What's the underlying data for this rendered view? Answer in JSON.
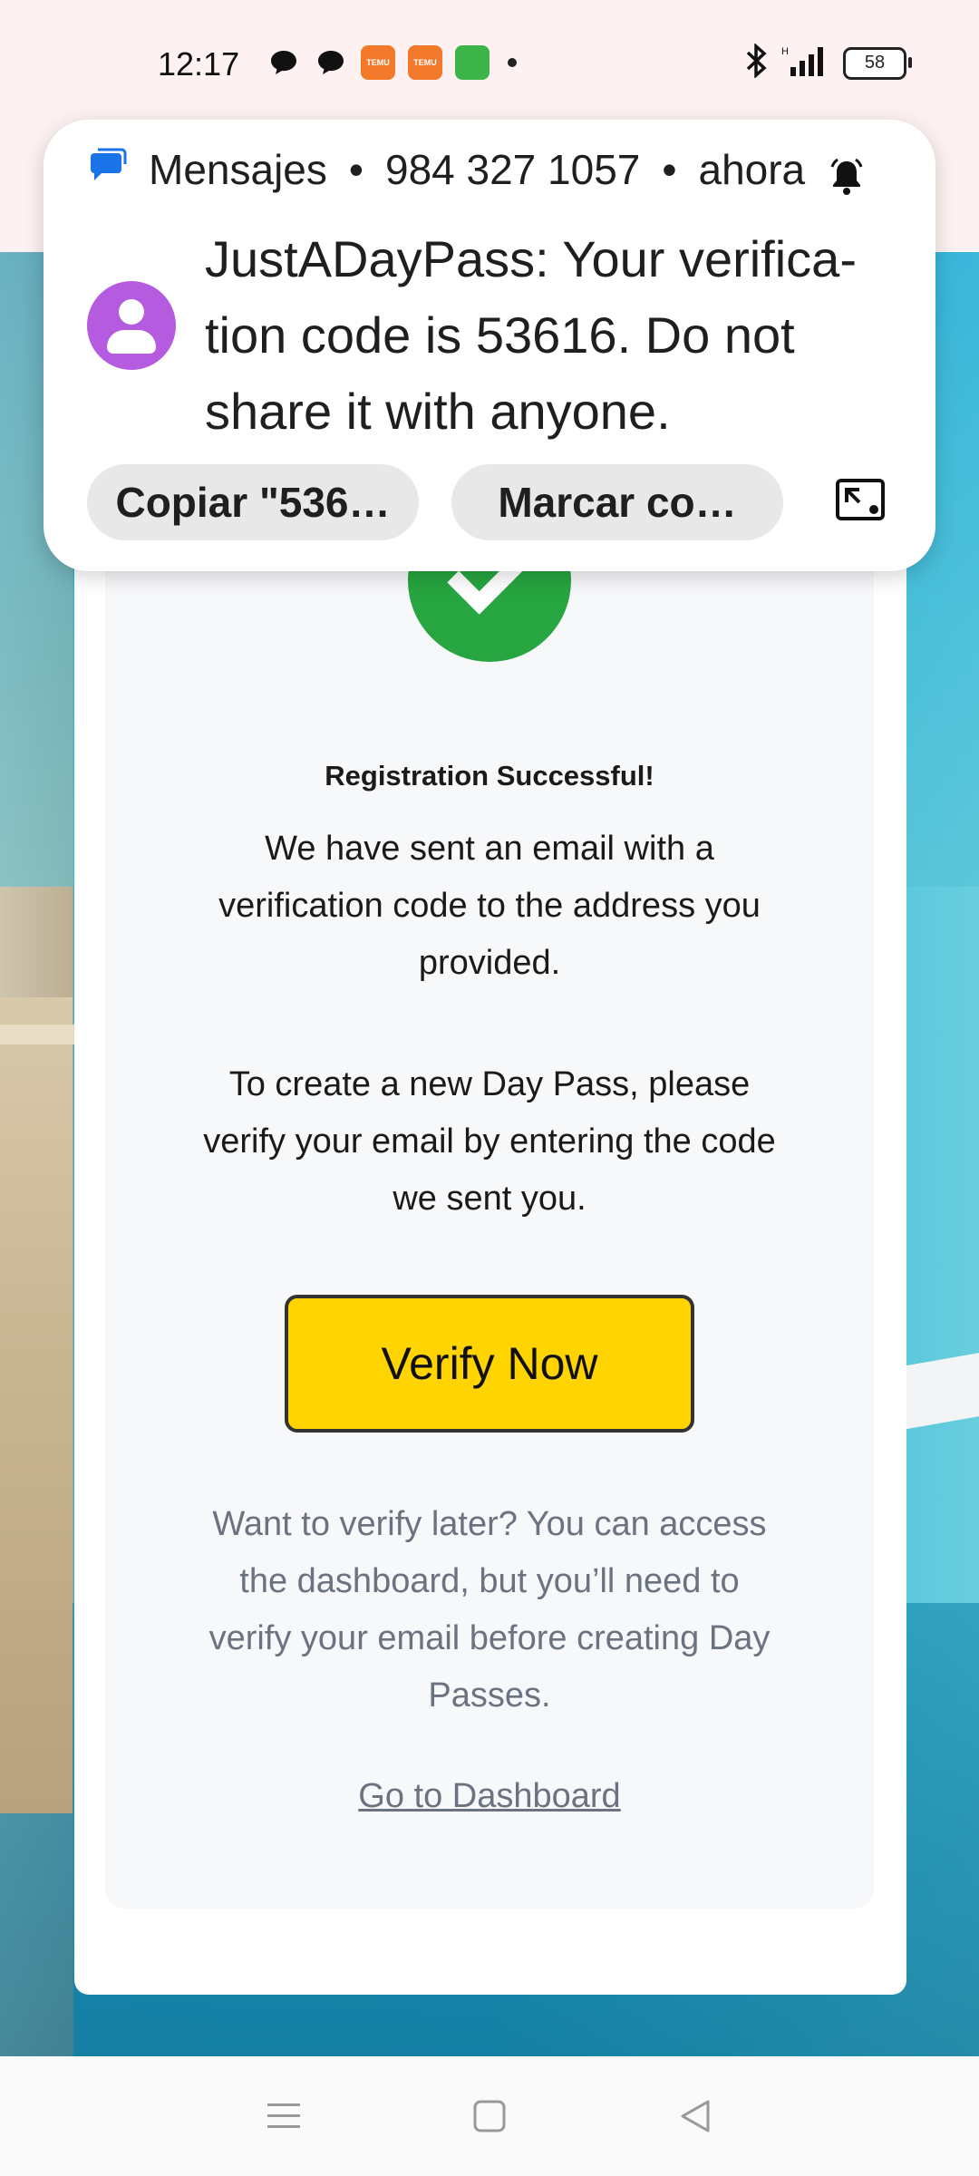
{
  "status_bar": {
    "time": "12:17",
    "temu_label": "TEMU",
    "battery_level": "58"
  },
  "notification": {
    "app_name": "Mensajes",
    "sender": "984 327 1057",
    "time": "ahora",
    "separator": "•",
    "message": "JustADayPass: Your verifica-tion code is 53616. Do not share it with anyone.",
    "actions": {
      "copy_label": "Copiar \"536…",
      "mark_label": "Marcar co…"
    }
  },
  "card": {
    "success_title": "Registration Successful!",
    "email_sent_text": "We have sent an email with a verification code to the address you provided.",
    "instruction_text": "To create a new Day Pass, please verify your email by entering the code we sent you.",
    "verify_button_label": "Verify Now",
    "later_text": "Want to verify later? You can access the dashboard, but you’ll need to verify your email before creating Day Passes.",
    "dashboard_link_label": "Go to Dashboard"
  },
  "colors": {
    "accent_yellow": "#ffd400",
    "success_green": "#27a540",
    "avatar_purple": "#b45be0",
    "messages_blue": "#1a73e8"
  },
  "icons": {
    "status_left": [
      "chat-bubble-icon",
      "chat-bubble-icon",
      "temu-app-icon",
      "temu-app-icon",
      "green-app-icon",
      "dot-icon"
    ],
    "status_right": [
      "bluetooth-icon",
      "signal-icon",
      "battery-icon"
    ],
    "notification": [
      "messages-app-icon",
      "bell-icon",
      "avatar-icon",
      "expand-icon"
    ],
    "nav": [
      "menu-icon",
      "home-icon",
      "back-icon"
    ]
  }
}
